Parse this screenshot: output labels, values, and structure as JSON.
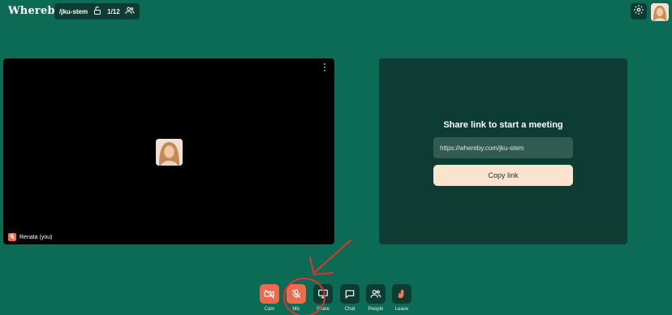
{
  "header": {
    "brand": "Whereby",
    "room_name": "/jku-stem",
    "participant_count": "1/12"
  },
  "self_tile": {
    "name": "Renata (you)"
  },
  "share_panel": {
    "title": "Share link to start a meeting",
    "url": "https://whereby.com/jku-stem",
    "copy_label": "Copy link"
  },
  "toolbar": {
    "cam": "Cam",
    "mic": "Mic",
    "share": "Share",
    "chat": "Chat",
    "people": "People",
    "leave": "Leave"
  },
  "colors": {
    "background": "#0b6b54",
    "panel": "#0d3c32",
    "active_red": "#ee6a4c",
    "copy_button": "#fbe4cf",
    "annotation": "#e0332e"
  },
  "icons": [
    "lock-open-icon",
    "people-icon",
    "gear-icon",
    "cam-off-icon",
    "mic-off-icon",
    "screen-share-icon",
    "chat-icon",
    "people-icon",
    "leave-hand-icon"
  ]
}
